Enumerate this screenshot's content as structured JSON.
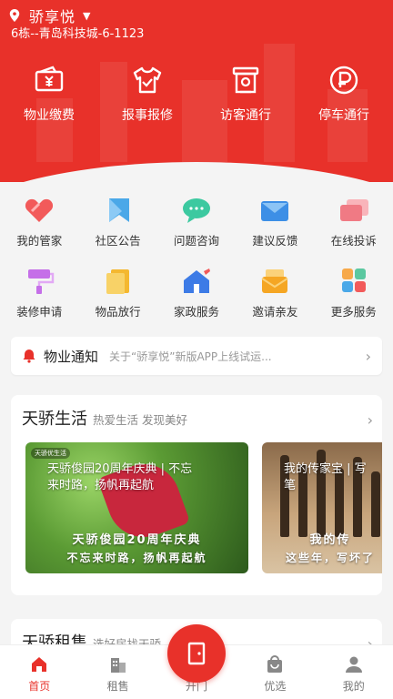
{
  "location": {
    "name": "骄享悦",
    "address": "6栋--青岛科技城-6-1123"
  },
  "quick": [
    {
      "label": "物业缴费",
      "icon": "wallet-yen-icon"
    },
    {
      "label": "报事报修",
      "icon": "repair-shirt-icon"
    },
    {
      "label": "访客通行",
      "icon": "visitor-pass-icon"
    },
    {
      "label": "停车通行",
      "icon": "parking-coin-icon"
    }
  ],
  "services": [
    {
      "label": "我的管家",
      "icon": "heart-icon",
      "color": "#f25a5a"
    },
    {
      "label": "社区公告",
      "icon": "bookmark-icon",
      "color": "#4aa8e8"
    },
    {
      "label": "问题咨询",
      "icon": "chat-bubble-icon",
      "color": "#3cc9a0"
    },
    {
      "label": "建议反馈",
      "icon": "envelope-icon",
      "color": "#3d8fe6"
    },
    {
      "label": "在线投诉",
      "icon": "cards-icon",
      "color": "#f07a84"
    },
    {
      "label": "装修申请",
      "icon": "paint-roller-icon",
      "color": "#c56fe8"
    },
    {
      "label": "物品放行",
      "icon": "box-icon",
      "color": "#f4b830"
    },
    {
      "label": "家政服务",
      "icon": "house-clean-icon",
      "color": "#3d7be6"
    },
    {
      "label": "邀请亲友",
      "icon": "invite-letter-icon",
      "color": "#f5a623"
    },
    {
      "label": "更多服务",
      "icon": "grid-more-icon",
      "color": "#5bc8a0"
    }
  ],
  "notice": {
    "title": "物业通知",
    "text": "关于“骄享悦”新版APP上线试运..."
  },
  "life": {
    "title": "天骄生活",
    "subtitle": "热爱生活  发现美好",
    "photos": [
      {
        "badge": "天骄优生活",
        "caption_line1": "天骄俊园20周年庆典 | 不忘",
        "caption_line2": "来时路，扬帆再起航",
        "overlay_line1": "天骄俊园20周年庆典",
        "overlay_line2": "不忘来时路，扬帆再起航"
      },
      {
        "caption_line1": "我的传家宝 | 写",
        "caption_line2": "笔",
        "overlay_line1": "我的传",
        "overlay_line2": "这些年，写坏了"
      }
    ]
  },
  "rent": {
    "title": "天骄租售",
    "subtitle": "选好房找天骄"
  },
  "tabs": [
    {
      "label": "首页",
      "icon": "home-icon",
      "active": true
    },
    {
      "label": "租售",
      "icon": "buildings-icon",
      "active": false
    },
    {
      "label": "开门",
      "icon": "door-icon",
      "active": false
    },
    {
      "label": "优选",
      "icon": "shopping-bag-icon",
      "active": false
    },
    {
      "label": "我的",
      "icon": "person-icon",
      "active": false
    }
  ],
  "colors": {
    "brand": "#e8312a"
  }
}
